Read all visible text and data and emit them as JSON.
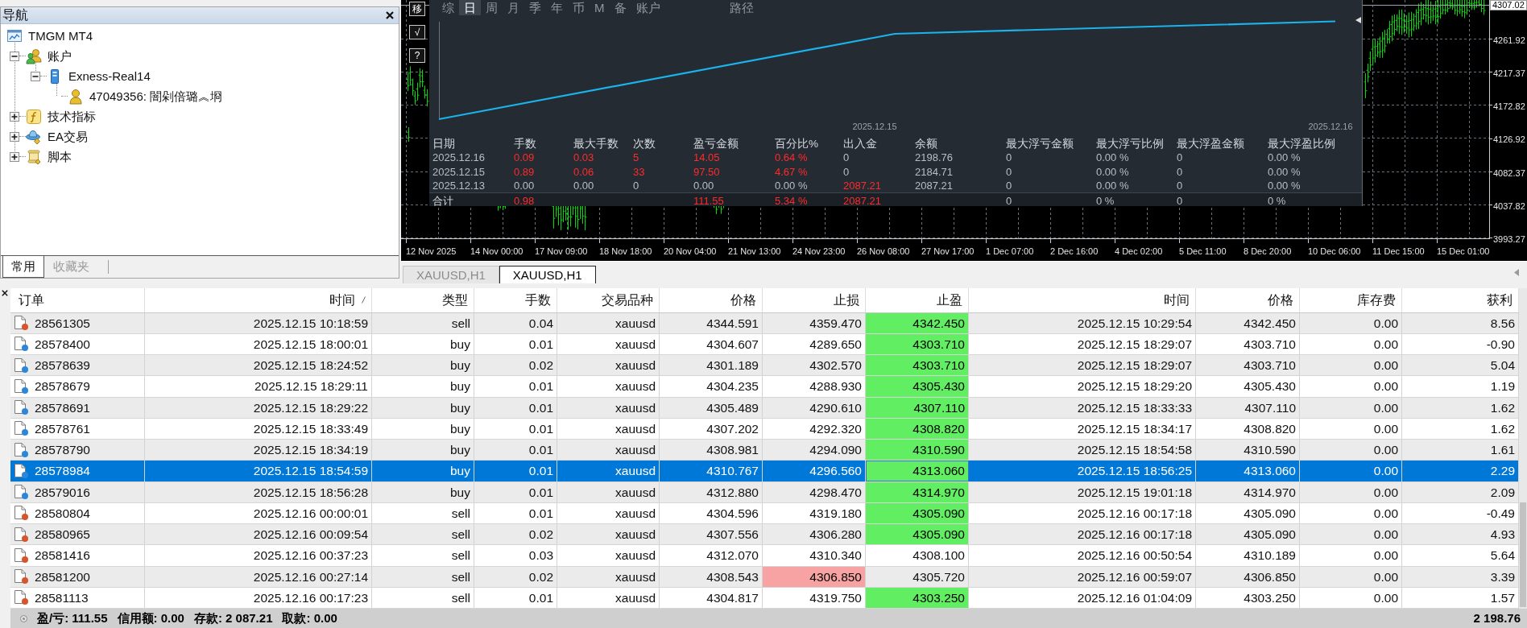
{
  "navigator": {
    "title": "导航",
    "tree": [
      {
        "kind": "terminal",
        "label": "TMGM MT4",
        "children": [
          {
            "kind": "accounts",
            "label": "账户",
            "expanded": true,
            "children": [
              {
                "kind": "server",
                "label": "Exness-Real14",
                "expanded": true,
                "children": [
                  {
                    "kind": "account",
                    "label": "47049356: 闇剁倍璐︽埛"
                  }
                ]
              }
            ]
          },
          {
            "kind": "indicators",
            "label": "技术指标",
            "expanded": false
          },
          {
            "kind": "experts",
            "label": "EA交易",
            "expanded": false
          },
          {
            "kind": "scripts",
            "label": "脚本",
            "expanded": false
          }
        ]
      }
    ],
    "tabs": [
      {
        "label": "常用",
        "selected": true
      },
      {
        "label": "收藏夹",
        "selected": false
      }
    ]
  },
  "chart": {
    "side_buttons": [
      "移",
      "√",
      "?"
    ],
    "report": {
      "tabs": [
        {
          "label": "综",
          "selected": false
        },
        {
          "label": "日",
          "selected": true
        },
        {
          "label": "周",
          "selected": false
        },
        {
          "label": "月",
          "selected": false
        },
        {
          "label": "季",
          "selected": false
        },
        {
          "label": "年",
          "selected": false
        },
        {
          "label": "币",
          "selected": false
        },
        {
          "label": "M",
          "selected": false
        },
        {
          "label": "备",
          "selected": false
        },
        {
          "label": "账户",
          "selected": false
        }
      ],
      "path_button": "路径",
      "x_labels": [
        "2025.12.15",
        "2025.12.16"
      ],
      "columns": [
        "日期",
        "手数",
        "最大手数",
        "次数",
        "盈亏金额",
        "百分比%",
        "出入金",
        "余额",
        "最大浮亏金额",
        "最大浮亏比例",
        "最大浮盈金额",
        "最大浮盈比例"
      ],
      "rows": [
        {
          "kind": "day",
          "cells": [
            {
              "text": "2025.12.16",
              "highlighted": false
            },
            {
              "text": "0.09",
              "highlighted": true
            },
            {
              "text": "0.03",
              "highlighted": true
            },
            {
              "text": "5",
              "highlighted": true
            },
            {
              "text": "14.05",
              "highlighted": true
            },
            {
              "text": "0.64 %",
              "highlighted": true
            },
            {
              "text": "0",
              "highlighted": false
            },
            {
              "text": "2198.76",
              "highlighted": false
            },
            {
              "text": "0",
              "highlighted": false
            },
            {
              "text": "0.00 %",
              "highlighted": false
            },
            {
              "text": "0",
              "highlighted": false
            },
            {
              "text": "0.00 %",
              "highlighted": false
            }
          ]
        },
        {
          "kind": "day",
          "cells": [
            {
              "text": "2025.12.15",
              "highlighted": false
            },
            {
              "text": "0.89",
              "highlighted": true
            },
            {
              "text": "0.06",
              "highlighted": true
            },
            {
              "text": "33",
              "highlighted": true
            },
            {
              "text": "97.50",
              "highlighted": true
            },
            {
              "text": "4.67 %",
              "highlighted": true
            },
            {
              "text": "0",
              "highlighted": false
            },
            {
              "text": "2184.71",
              "highlighted": false
            },
            {
              "text": "0",
              "highlighted": false
            },
            {
              "text": "0.00 %",
              "highlighted": false
            },
            {
              "text": "0",
              "highlighted": false
            },
            {
              "text": "0.00 %",
              "highlighted": false
            }
          ]
        },
        {
          "kind": "day",
          "cells": [
            {
              "text": "2025.12.13",
              "highlighted": false
            },
            {
              "text": "0.00",
              "highlighted": false
            },
            {
              "text": "0.00",
              "highlighted": false
            },
            {
              "text": "0",
              "highlighted": false
            },
            {
              "text": "0.00",
              "highlighted": false
            },
            {
              "text": "0.00 %",
              "highlighted": false
            },
            {
              "text": "2087.21",
              "highlighted": true
            },
            {
              "text": "2087.21",
              "highlighted": false
            },
            {
              "text": "0",
              "highlighted": false
            },
            {
              "text": "0.00 %",
              "highlighted": false
            },
            {
              "text": "0",
              "highlighted": false
            },
            {
              "text": "0.00 %",
              "highlighted": false
            }
          ]
        },
        {
          "kind": "total",
          "cells": [
            {
              "text": "合计",
              "highlighted": false
            },
            {
              "text": "0.98",
              "highlighted": true
            },
            null,
            null,
            {
              "text": "111.55",
              "highlighted": true
            },
            {
              "text": "5.34 %",
              "highlighted": true
            },
            {
              "text": "2087.21",
              "highlighted": true
            },
            null,
            {
              "text": "0",
              "highlighted": false
            },
            {
              "text": "0 %",
              "highlighted": false
            },
            {
              "text": "0",
              "highlighted": false
            },
            {
              "text": "0 %",
              "highlighted": false
            }
          ]
        }
      ]
    },
    "price_axis": {
      "current": "4307.02",
      "labels": [
        "4261.92",
        "4217.37",
        "4172.82",
        "4126.92",
        "4082.37",
        "4037.82",
        "3993.27"
      ]
    },
    "time_labels": [
      "12 Nov 2025",
      "14 Nov 00:00",
      "17 Nov 09:00",
      "18 Nov 18:00",
      "20 Nov 04:00",
      "21 Nov 13:00",
      "24 Nov 23:00",
      "26 Nov 08:00",
      "27 Nov 17:00",
      "1 Dec 07:00",
      "2 Dec 16:00",
      "4 Dec 02:00",
      "5 Dec 11:00",
      "8 Dec 20:00",
      "10 Dec 06:00",
      "11 Dec 15:00",
      "15 Dec 01:00"
    ]
  },
  "chart_tabs": [
    {
      "label": "XAUUSD,H1",
      "selected": false
    },
    {
      "label": "XAUUSD,H1",
      "selected": true
    }
  ],
  "terminal": {
    "columns": [
      {
        "label": "订单",
        "sorted": false
      },
      {
        "label": "时间",
        "sorted": true
      },
      {
        "label": "类型",
        "sorted": false
      },
      {
        "label": "手数",
        "sorted": false
      },
      {
        "label": "交易品种",
        "sorted": false
      },
      {
        "label": "价格",
        "sorted": false
      },
      {
        "label": "止损",
        "sorted": false
      },
      {
        "label": "止盈",
        "sorted": false
      },
      {
        "label": "时间",
        "sorted": false
      },
      {
        "label": "价格",
        "sorted": false
      },
      {
        "label": "库存费",
        "sorted": false
      },
      {
        "label": "获利",
        "sorted": false
      }
    ],
    "rows": [
      {
        "order": "28561305",
        "open_time": "2025.12.15 10:18:59",
        "type": "sell",
        "lots": "0.04",
        "symbol": "xauusd",
        "open_price": "4344.591",
        "stop_loss": "4359.470",
        "take_profit": "4342.450",
        "close_time": "2025.12.15 10:29:54",
        "close_price": "4342.450",
        "swap": "0.00",
        "profit": "8.56",
        "color": "#d9532b",
        "selected": false,
        "tp_hit": true,
        "sl_hit": false
      },
      {
        "order": "28578400",
        "open_time": "2025.12.15 18:00:01",
        "type": "buy",
        "lots": "0.01",
        "symbol": "xauusd",
        "open_price": "4304.607",
        "stop_loss": "4289.650",
        "take_profit": "4303.710",
        "close_time": "2025.12.15 18:29:07",
        "close_price": "4303.710",
        "swap": "0.00",
        "profit": "-0.90",
        "color": "#2d86d9",
        "selected": false,
        "tp_hit": true,
        "sl_hit": false
      },
      {
        "order": "28578639",
        "open_time": "2025.12.15 18:24:52",
        "type": "buy",
        "lots": "0.02",
        "symbol": "xauusd",
        "open_price": "4301.189",
        "stop_loss": "4302.570",
        "take_profit": "4303.710",
        "close_time": "2025.12.15 18:29:07",
        "close_price": "4303.710",
        "swap": "0.00",
        "profit": "5.04",
        "color": "#2d86d9",
        "selected": false,
        "tp_hit": true,
        "sl_hit": false
      },
      {
        "order": "28578679",
        "open_time": "2025.12.15 18:29:11",
        "type": "buy",
        "lots": "0.01",
        "symbol": "xauusd",
        "open_price": "4304.235",
        "stop_loss": "4288.930",
        "take_profit": "4305.430",
        "close_time": "2025.12.15 18:29:20",
        "close_price": "4305.430",
        "swap": "0.00",
        "profit": "1.19",
        "color": "#2d86d9",
        "selected": false,
        "tp_hit": true,
        "sl_hit": false
      },
      {
        "order": "28578691",
        "open_time": "2025.12.15 18:29:22",
        "type": "buy",
        "lots": "0.01",
        "symbol": "xauusd",
        "open_price": "4305.489",
        "stop_loss": "4290.610",
        "take_profit": "4307.110",
        "close_time": "2025.12.15 18:33:33",
        "close_price": "4307.110",
        "swap": "0.00",
        "profit": "1.62",
        "color": "#2d86d9",
        "selected": false,
        "tp_hit": true,
        "sl_hit": false
      },
      {
        "order": "28578761",
        "open_time": "2025.12.15 18:33:49",
        "type": "buy",
        "lots": "0.01",
        "symbol": "xauusd",
        "open_price": "4307.202",
        "stop_loss": "4292.320",
        "take_profit": "4308.820",
        "close_time": "2025.12.15 18:34:17",
        "close_price": "4308.820",
        "swap": "0.00",
        "profit": "1.62",
        "color": "#2d86d9",
        "selected": false,
        "tp_hit": true,
        "sl_hit": false
      },
      {
        "order": "28578790",
        "open_time": "2025.12.15 18:34:19",
        "type": "buy",
        "lots": "0.01",
        "symbol": "xauusd",
        "open_price": "4308.981",
        "stop_loss": "4294.090",
        "take_profit": "4310.590",
        "close_time": "2025.12.15 18:54:58",
        "close_price": "4310.590",
        "swap": "0.00",
        "profit": "1.61",
        "color": "#2d86d9",
        "selected": false,
        "tp_hit": true,
        "sl_hit": false
      },
      {
        "order": "28578984",
        "open_time": "2025.12.15 18:54:59",
        "type": "buy",
        "lots": "0.01",
        "symbol": "xauusd",
        "open_price": "4310.767",
        "stop_loss": "4296.560",
        "take_profit": "4313.060",
        "close_time": "2025.12.15 18:56:25",
        "close_price": "4313.060",
        "swap": "0.00",
        "profit": "2.29",
        "color": "#2d86d9",
        "selected": true,
        "tp_hit": true,
        "sl_hit": false
      },
      {
        "order": "28579016",
        "open_time": "2025.12.15 18:56:28",
        "type": "buy",
        "lots": "0.01",
        "symbol": "xauusd",
        "open_price": "4312.880",
        "stop_loss": "4298.470",
        "take_profit": "4314.970",
        "close_time": "2025.12.15 19:01:18",
        "close_price": "4314.970",
        "swap": "0.00",
        "profit": "2.09",
        "color": "#2d86d9",
        "selected": false,
        "tp_hit": true,
        "sl_hit": false
      },
      {
        "order": "28580804",
        "open_time": "2025.12.16 00:00:01",
        "type": "sell",
        "lots": "0.01",
        "symbol": "xauusd",
        "open_price": "4304.596",
        "stop_loss": "4319.180",
        "take_profit": "4305.090",
        "close_time": "2025.12.16 00:17:18",
        "close_price": "4305.090",
        "swap": "0.00",
        "profit": "-0.49",
        "color": "#d9532b",
        "selected": false,
        "tp_hit": true,
        "sl_hit": false
      },
      {
        "order": "28580965",
        "open_time": "2025.12.16 00:09:54",
        "type": "sell",
        "lots": "0.02",
        "symbol": "xauusd",
        "open_price": "4307.556",
        "stop_loss": "4306.280",
        "take_profit": "4305.090",
        "close_time": "2025.12.16 00:17:18",
        "close_price": "4305.090",
        "swap": "0.00",
        "profit": "4.93",
        "color": "#d9532b",
        "selected": false,
        "tp_hit": true,
        "sl_hit": false
      },
      {
        "order": "28581416",
        "open_time": "2025.12.16 00:37:23",
        "type": "sell",
        "lots": "0.03",
        "symbol": "xauusd",
        "open_price": "4312.070",
        "stop_loss": "4310.340",
        "take_profit": "4308.100",
        "close_time": "2025.12.16 00:50:54",
        "close_price": "4310.189",
        "swap": "0.00",
        "profit": "5.64",
        "color": "#d9532b",
        "selected": false,
        "tp_hit": false,
        "sl_hit": false
      },
      {
        "order": "28581200",
        "open_time": "2025.12.16 00:27:14",
        "type": "sell",
        "lots": "0.02",
        "symbol": "xauusd",
        "open_price": "4308.543",
        "stop_loss": "4306.850",
        "take_profit": "4305.720",
        "close_time": "2025.12.16 00:59:07",
        "close_price": "4306.850",
        "swap": "0.00",
        "profit": "3.39",
        "color": "#d9532b",
        "selected": false,
        "tp_hit": false,
        "sl_hit": true
      },
      {
        "order": "28581113",
        "open_time": "2025.12.16 00:17:23",
        "type": "sell",
        "lots": "0.01",
        "symbol": "xauusd",
        "open_price": "4304.817",
        "stop_loss": "4319.750",
        "take_profit": "4303.250",
        "close_time": "2025.12.16 01:04:09",
        "close_price": "4303.250",
        "swap": "0.00",
        "profit": "1.57",
        "color": "#d9532b",
        "selected": false,
        "tp_hit": true,
        "sl_hit": false
      }
    ],
    "status": {
      "items": [
        "盈/亏: 111.55",
        "信用额: 0.00",
        "存款: 2 087.21",
        "取款: 0.00"
      ],
      "balance": "2 198.76"
    }
  }
}
